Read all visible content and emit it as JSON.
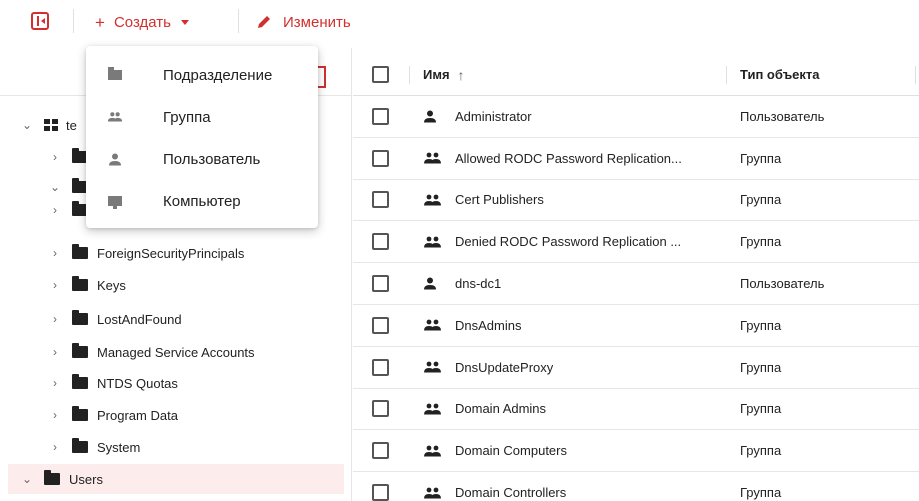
{
  "toolbar": {
    "create_label": "Создать",
    "create_icon": "plus-icon",
    "edit_label": "Изменить",
    "edit_icon": "pencil-icon",
    "accent": "#d32f2f"
  },
  "create_menu": [
    {
      "label": "Подразделение",
      "icon": "folder-icon"
    },
    {
      "label": "Группа",
      "icon": "group-icon"
    },
    {
      "label": "Пользователь",
      "icon": "user-icon"
    },
    {
      "label": "Компьютер",
      "icon": "computer-icon"
    }
  ],
  "tree": {
    "root_label": "te",
    "items": [
      {
        "label": "ForeignSecurityPrincipals"
      },
      {
        "label": "Keys"
      },
      {
        "label": "LostAndFound"
      },
      {
        "label": "Managed Service Accounts"
      },
      {
        "label": "NTDS Quotas"
      },
      {
        "label": "Program Data"
      },
      {
        "label": "System"
      },
      {
        "label": "Users",
        "selected": true
      }
    ],
    "selected_bg": "#fdecec"
  },
  "table": {
    "columns": {
      "name": "Имя",
      "type": "Тип объекта"
    },
    "sort": "ascending",
    "rows": [
      {
        "name": "Administrator",
        "type": "Пользователь",
        "icon": "user-icon"
      },
      {
        "name": "Allowed RODC Password Replication...",
        "type": "Группа",
        "icon": "group-icon"
      },
      {
        "name": "Cert Publishers",
        "type": "Группа",
        "icon": "group-icon"
      },
      {
        "name": "Denied RODC Password Replication ...",
        "type": "Группа",
        "icon": "group-icon"
      },
      {
        "name": "dns-dc1",
        "type": "Пользователь",
        "icon": "user-icon"
      },
      {
        "name": "DnsAdmins",
        "type": "Группа",
        "icon": "group-icon"
      },
      {
        "name": "DnsUpdateProxy",
        "type": "Группа",
        "icon": "group-icon"
      },
      {
        "name": "Domain Admins",
        "type": "Группа",
        "icon": "group-icon"
      },
      {
        "name": "Domain Computers",
        "type": "Группа",
        "icon": "group-icon"
      },
      {
        "name": "Domain Controllers",
        "type": "Группа",
        "icon": "group-icon"
      }
    ]
  }
}
